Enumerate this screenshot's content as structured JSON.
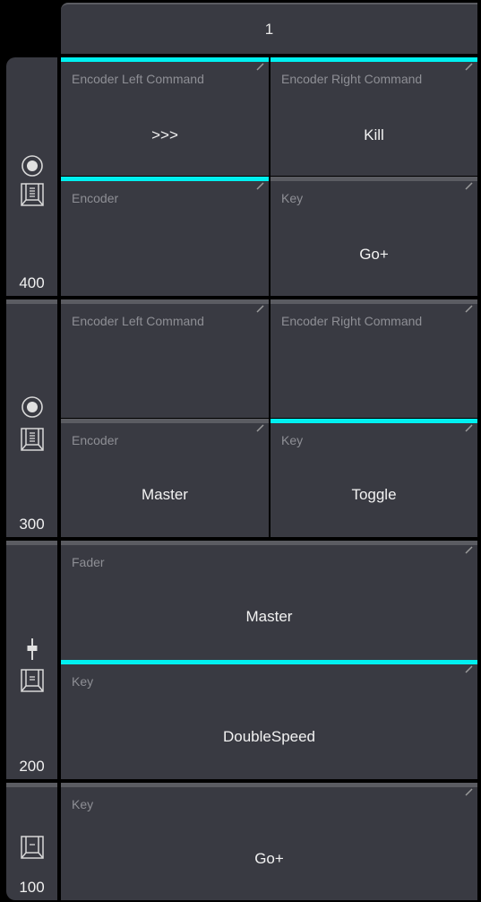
{
  "header": {
    "page_label": "1"
  },
  "colors": {
    "active": "#00f0f0",
    "cell_bg": "#393a42",
    "inactive_bar": "#5b5c62"
  },
  "executors": [
    {
      "number": "400",
      "icons": [
        "encoder-knob-icon",
        "key-icon"
      ],
      "cells": [
        {
          "label": "Encoder Left Command",
          "value": ">>>",
          "active": true
        },
        {
          "label": "Encoder Right Command",
          "value": "Kill",
          "active": true
        },
        {
          "label": "Encoder",
          "value": "",
          "active": true
        },
        {
          "label": "Key",
          "value": "Go+",
          "active": false
        }
      ]
    },
    {
      "number": "300",
      "icons": [
        "encoder-knob-icon",
        "key-icon"
      ],
      "cells": [
        {
          "label": "Encoder Left Command",
          "value": "",
          "active": false
        },
        {
          "label": "Encoder Right Command",
          "value": "",
          "active": false
        },
        {
          "label": "Encoder",
          "value": "Master",
          "active": false
        },
        {
          "label": "Key",
          "value": "Toggle",
          "active": true
        }
      ]
    },
    {
      "number": "200",
      "icons": [
        "fader-icon",
        "key-icon"
      ],
      "cells": [
        {
          "label": "Fader",
          "value": "Master",
          "active": false
        },
        {
          "label": "Key",
          "value": "DoubleSpeed",
          "active": true
        }
      ]
    },
    {
      "number": "100",
      "icons": [
        "key-icon"
      ],
      "cells": [
        {
          "label": "Key",
          "value": "Go+",
          "active": false
        }
      ]
    }
  ]
}
